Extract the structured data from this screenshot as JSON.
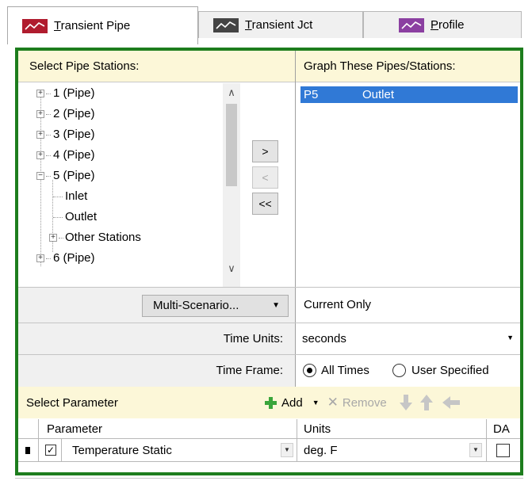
{
  "tabs": [
    {
      "label_mnemonic": "T",
      "label_rest": "ransient Pipe",
      "icon": "chart-line-red-icon",
      "color": "#b01c2e",
      "active": true
    },
    {
      "label_mnemonic": "T",
      "label_rest": "ransient Jct",
      "icon": "chart-line-gray-icon",
      "color": "#444444",
      "active": false
    },
    {
      "label_mnemonic": "P",
      "label_rest": "rofile",
      "icon": "chart-line-purple-icon",
      "color": "#8b3fa1",
      "active": false
    }
  ],
  "accent_green": "#1d7d1d",
  "header": {
    "left_title": "Select Pipe Stations:",
    "right_title": "Graph These Pipes/Stations:"
  },
  "tree": [
    {
      "label": "1 (Pipe)",
      "expander": "+"
    },
    {
      "label": "2 (Pipe)",
      "expander": "+"
    },
    {
      "label": "3 (Pipe)",
      "expander": "+"
    },
    {
      "label": "4 (Pipe)",
      "expander": "+"
    },
    {
      "label": "5 (Pipe)",
      "expander": "−"
    },
    {
      "label": "Inlet"
    },
    {
      "label": "Outlet"
    },
    {
      "label": "Other Stations",
      "expander": "+"
    },
    {
      "label": "6 (Pipe)",
      "expander": "+"
    }
  ],
  "move_buttons": {
    "add": ">",
    "remove": "<",
    "remove_all": "<<"
  },
  "graph_list": [
    {
      "pipe": "P5",
      "station": "Outlet"
    }
  ],
  "scenario": {
    "button_label": "Multi-Scenario...",
    "value": "Current Only"
  },
  "time_units": {
    "label": "Time Units:",
    "value": "seconds"
  },
  "time_frame": {
    "label": "Time Frame:",
    "option_all": "All Times",
    "option_user": "User Specified",
    "selected": "All Times"
  },
  "parameter_section": {
    "title": "Select Parameter",
    "add_label": "Add",
    "remove_label": "Remove"
  },
  "grid": {
    "columns": {
      "parameter": "Parameter",
      "units": "Units",
      "da": "DA"
    },
    "rows": [
      {
        "checked": true,
        "parameter": "Temperature Static",
        "units": "deg. F",
        "da": false
      }
    ]
  }
}
